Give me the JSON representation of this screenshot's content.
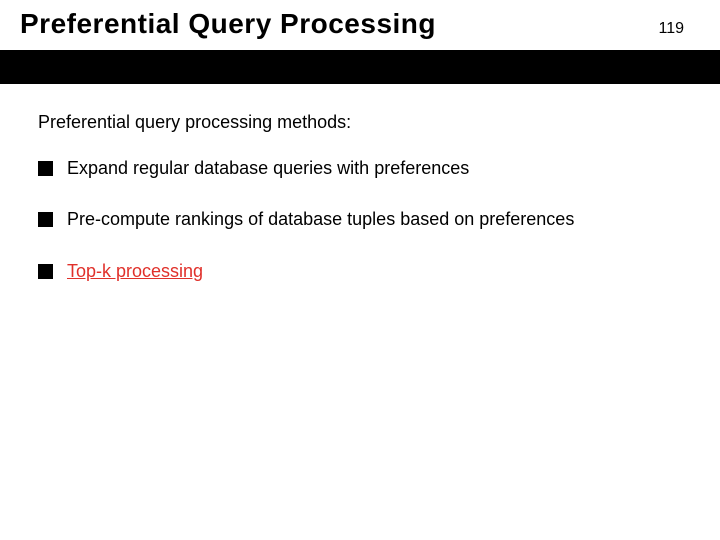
{
  "header": {
    "title": "Preferential Query Processing",
    "page_number": "119"
  },
  "body": {
    "lead": "Preferential query processing methods:",
    "bullets": [
      {
        "text": "Expand regular database queries with preferences",
        "is_link": false
      },
      {
        "text": "Pre-compute rankings of database tuples based on preferences",
        "is_link": false
      },
      {
        "text": "Top-k processing",
        "is_link": true
      }
    ]
  }
}
